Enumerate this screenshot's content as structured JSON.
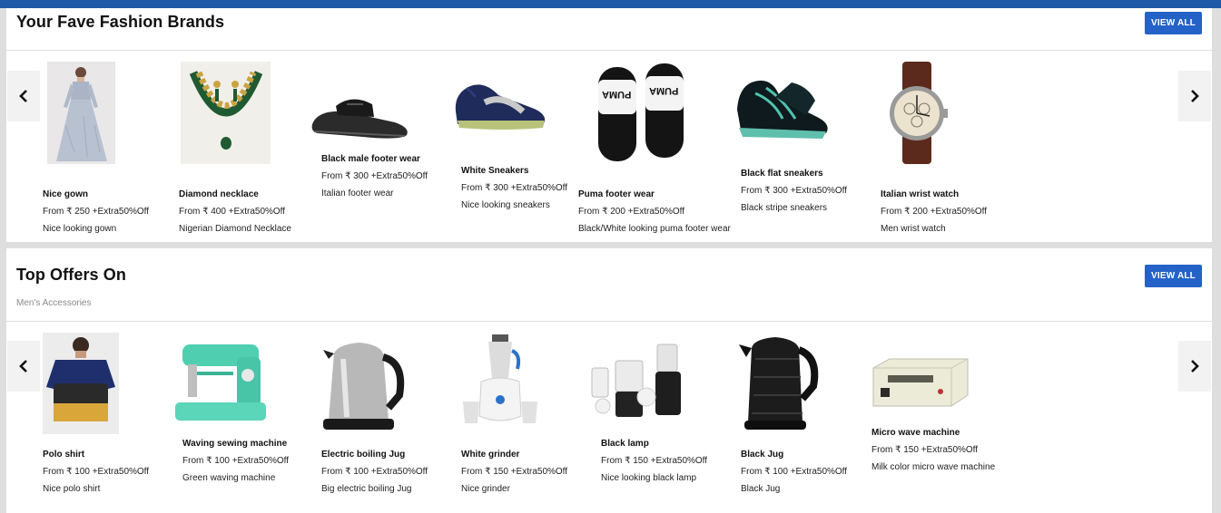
{
  "colors": {
    "header_bar": "#1e5aa8",
    "view_all_button": "#2462c8",
    "page_background": "#dedede"
  },
  "sections": [
    {
      "title": "Your Fave Fashion Brands",
      "subtitle": "",
      "view_all_label": "VIEW ALL",
      "products": [
        {
          "name": "Nice gown",
          "price": "From ₹ 250 +Extra50%Off",
          "desc": "Nice looking gown",
          "icon": "gown-image"
        },
        {
          "name": "Diamond necklace",
          "price": "From ₹ 400 +Extra50%Off",
          "desc": "Nigerian Diamond Necklace",
          "icon": "necklace-image"
        },
        {
          "name": "Black male footer wear",
          "price": "From ₹ 300 +Extra50%Off",
          "desc": "Italian footer wear",
          "icon": "sandal-image"
        },
        {
          "name": "White Sneakers",
          "price": "From ₹ 300 +Extra50%Off",
          "desc": "Nice looking sneakers",
          "icon": "sneaker-image"
        },
        {
          "name": "Puma footer wear",
          "price": "From ₹ 200 +Extra50%Off",
          "desc": "Black/White looking puma footer wear",
          "icon": "slides-image",
          "image_label": "PUMA"
        },
        {
          "name": "Black flat sneakers",
          "price": "From ₹ 300 +Extra50%Off",
          "desc": "Black stripe sneakers",
          "icon": "sneaker-image"
        },
        {
          "name": "Italian wrist watch",
          "price": "From ₹ 200 +Extra50%Off",
          "desc": "Men wrist watch",
          "icon": "watch-image"
        }
      ]
    },
    {
      "title": "Top Offers On",
      "subtitle": "Men's Accessories",
      "view_all_label": "VIEW ALL",
      "products": [
        {
          "name": "Polo shirt",
          "price": "From ₹ 100 +Extra50%Off",
          "desc": "Nice polo shirt",
          "icon": "shirt-image"
        },
        {
          "name": "Waving sewing machine",
          "price": "From ₹ 100 +Extra50%Off",
          "desc": "Green waving machine",
          "icon": "sewing-machine-image"
        },
        {
          "name": "Electric boiling Jug",
          "price": "From ₹ 100 +Extra50%Off",
          "desc": "Big electric boiling Jug",
          "icon": "kettle-image"
        },
        {
          "name": "White grinder",
          "price": "From ₹ 150 +Extra50%Off",
          "desc": "Nice grinder",
          "icon": "grinder-image"
        },
        {
          "name": "Black lamp",
          "price": "From ₹ 150 +Extra50%Off",
          "desc": "Nice looking black lamp",
          "icon": "blender-image"
        },
        {
          "name": "Black Jug",
          "price": "From ₹ 100 +Extra50%Off",
          "desc": "Black Jug",
          "icon": "kettle-image"
        },
        {
          "name": "Micro wave machine",
          "price": "From ₹ 150 +Extra50%Off",
          "desc": "Milk color micro wave machine",
          "icon": "inverter-image"
        }
      ]
    }
  ],
  "arrow_icons": {
    "left": "chevron-left-icon",
    "right": "chevron-right-icon"
  }
}
